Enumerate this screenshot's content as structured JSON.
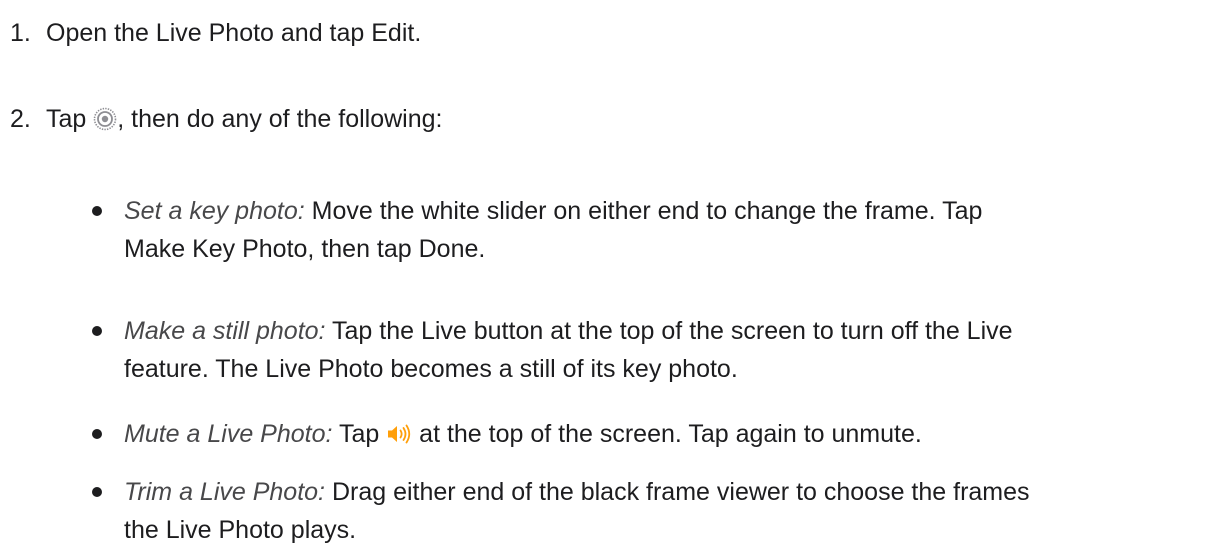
{
  "steps": [
    {
      "number": "1.",
      "text": "Open the Live Photo and tap Edit."
    },
    {
      "number": "2.",
      "text_before": "Tap ",
      "icon": "live-photo-icon",
      "text_after": ", then do any of the following:"
    }
  ],
  "bullets": [
    {
      "term": "Set a key photo:",
      "line1": " Move the white slider on either end to change the frame. Tap",
      "line2": "Make Key Photo, then tap Done."
    },
    {
      "term": "Make a still photo:",
      "line1": " Tap the Live button at the top of the screen to turn off the Live",
      "line2": "feature. The Live Photo becomes a still of its key photo."
    },
    {
      "term": "Mute a Live Photo:",
      "text_before": " Tap ",
      "icon": "speaker-icon",
      "text_after": " at the top of the screen. Tap again to unmute."
    },
    {
      "term": "Trim a Live Photo:",
      "line1": " Drag either end of the black frame viewer to choose the frames",
      "line2": "the Live Photo plays."
    }
  ],
  "colors": {
    "text": "#1d1d1f",
    "term": "#48484a",
    "live_icon": "#8e8e93",
    "speaker_icon": "#ff9f0a"
  }
}
